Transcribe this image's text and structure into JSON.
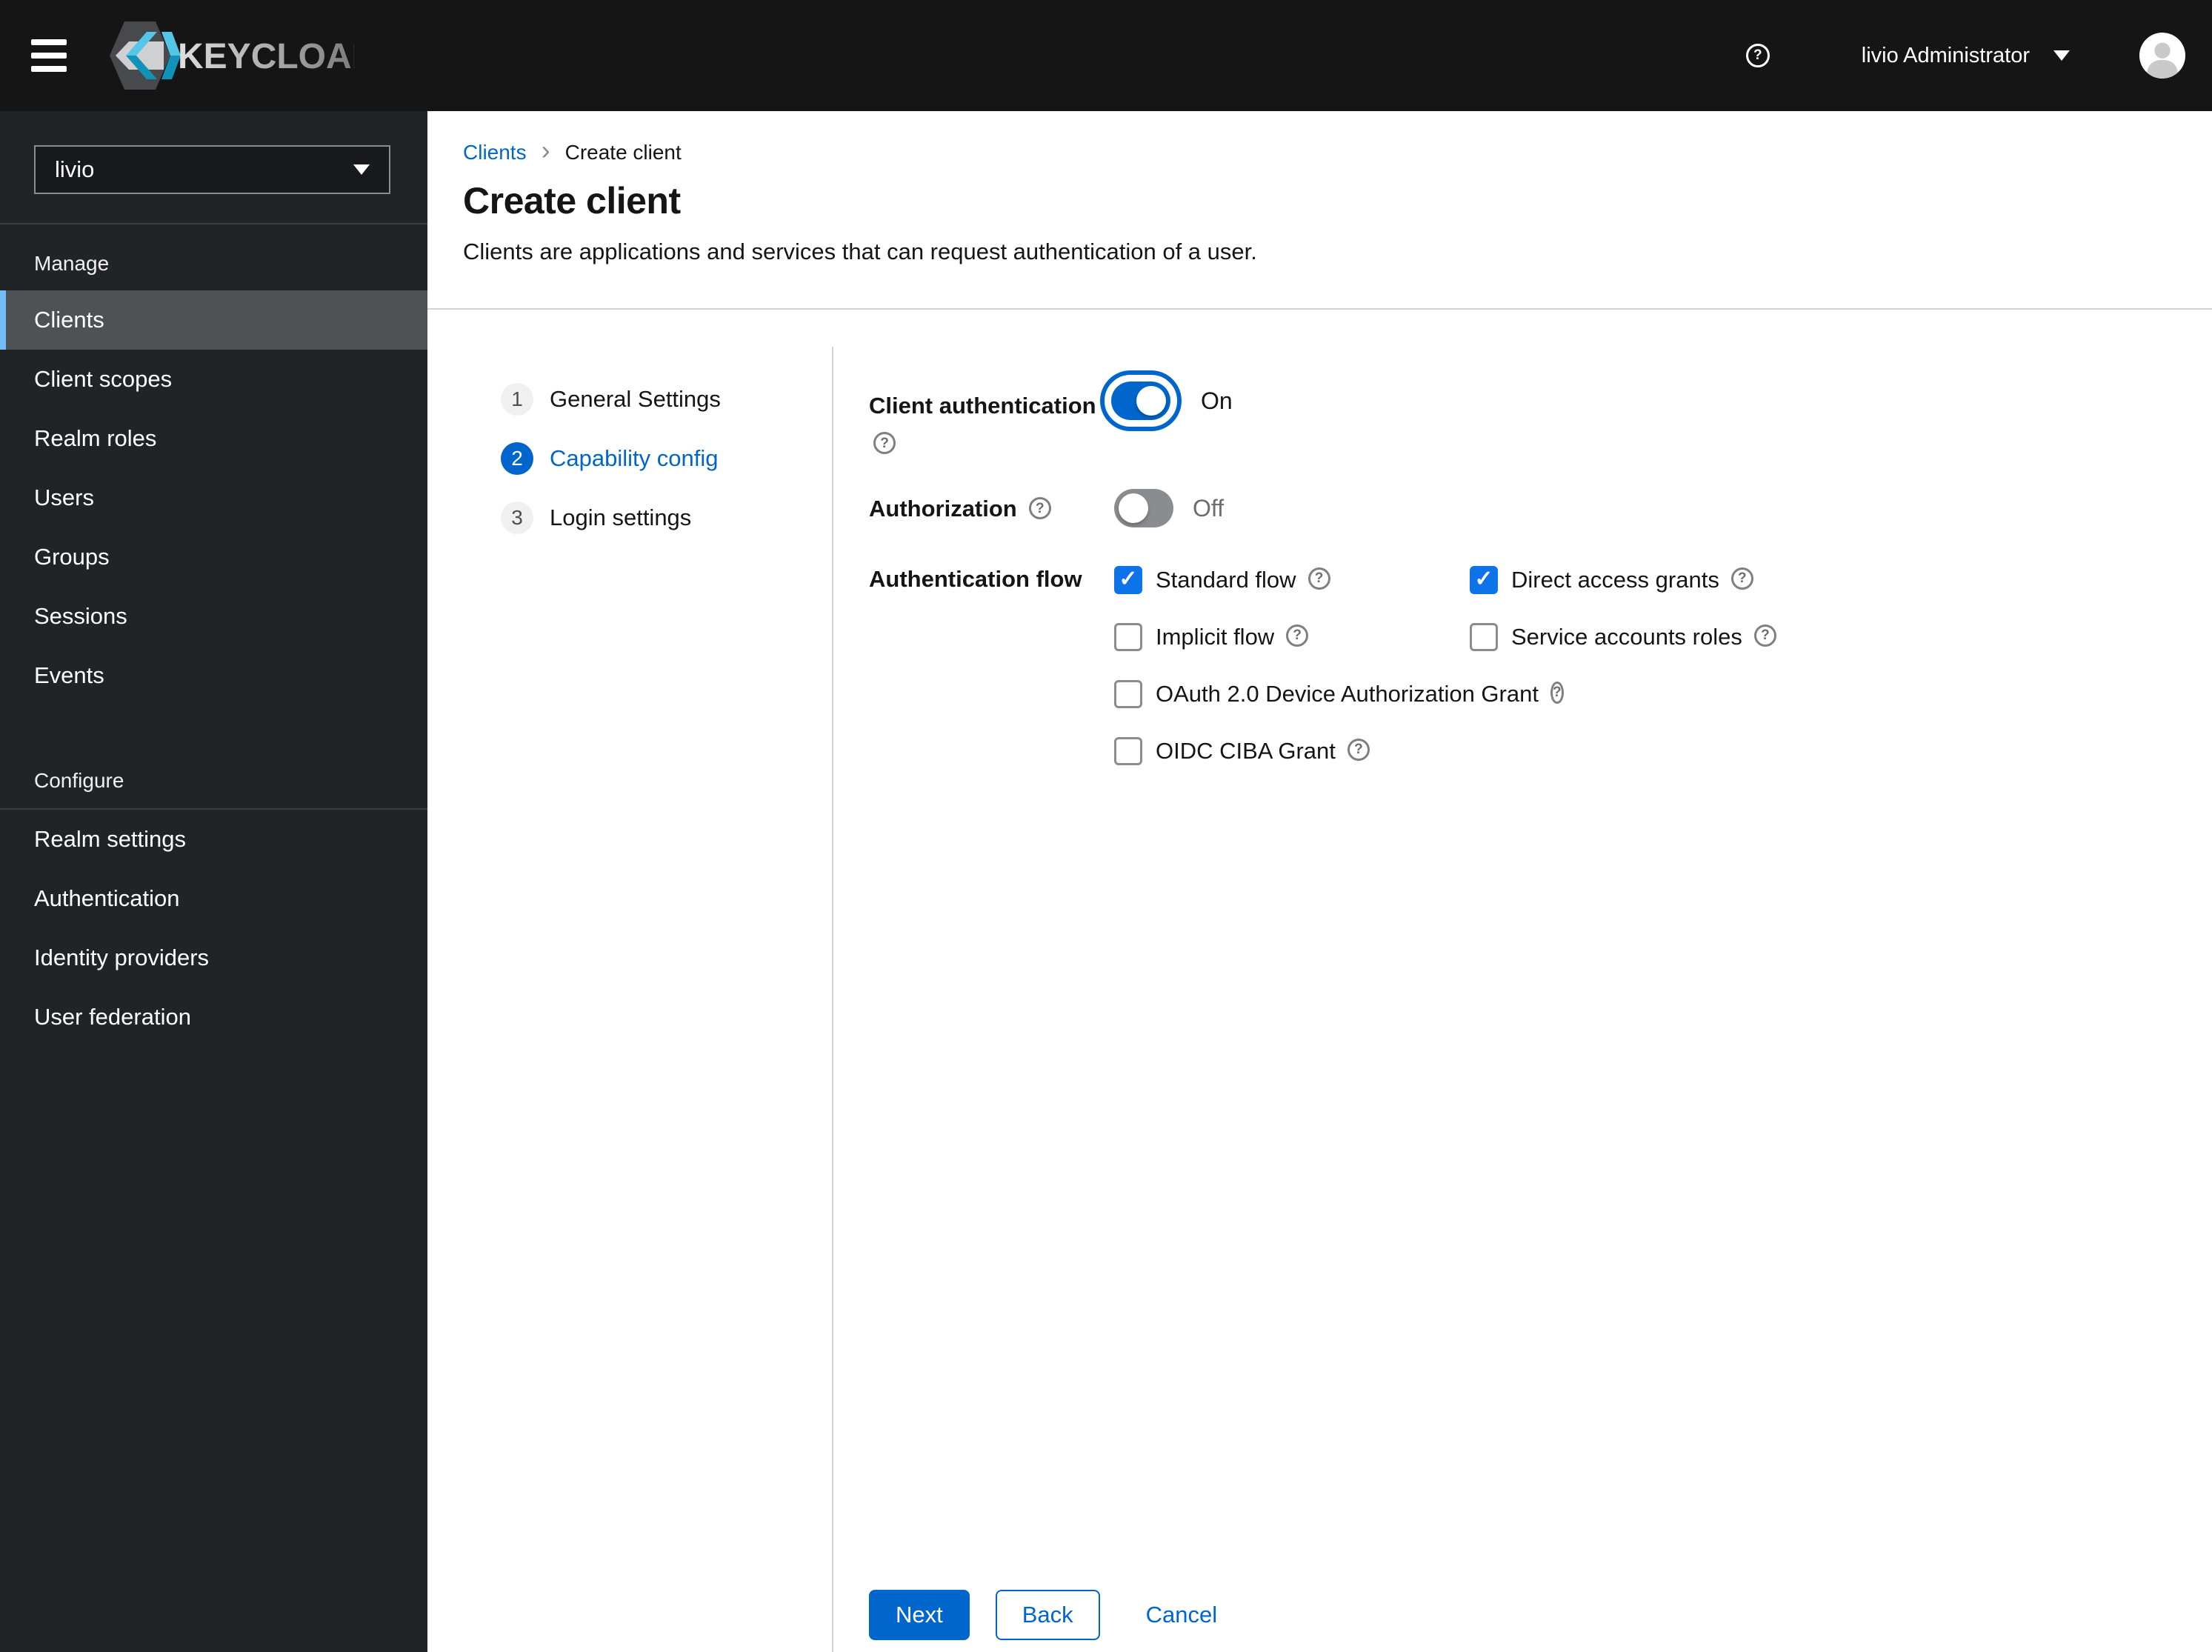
{
  "header": {
    "brand": "KEYCLOAK",
    "user": "livio Administrator"
  },
  "sidebar": {
    "realm": "livio",
    "sections": [
      {
        "title": "Manage",
        "items": [
          {
            "label": "Clients",
            "active": true
          },
          {
            "label": "Client scopes",
            "active": false
          },
          {
            "label": "Realm roles",
            "active": false
          },
          {
            "label": "Users",
            "active": false
          },
          {
            "label": "Groups",
            "active": false
          },
          {
            "label": "Sessions",
            "active": false
          },
          {
            "label": "Events",
            "active": false
          }
        ]
      },
      {
        "title": "Configure",
        "items": [
          {
            "label": "Realm settings",
            "active": false
          },
          {
            "label": "Authentication",
            "active": false
          },
          {
            "label": "Identity providers",
            "active": false
          },
          {
            "label": "User federation",
            "active": false
          }
        ]
      }
    ]
  },
  "breadcrumb": {
    "parent": "Clients",
    "current": "Create client"
  },
  "page": {
    "title": "Create client",
    "description": "Clients are applications and services that can request authentication of a user."
  },
  "wizard": {
    "steps": [
      {
        "number": "1",
        "label": "General Settings",
        "active": false
      },
      {
        "number": "2",
        "label": "Capability config",
        "active": true
      },
      {
        "number": "3",
        "label": "Login settings",
        "active": false
      }
    ]
  },
  "form": {
    "client_authentication": {
      "label": "Client authentication",
      "on": true,
      "state": "On"
    },
    "authorization": {
      "label": "Authorization",
      "on": false,
      "state": "Off"
    },
    "authentication_flow": {
      "label": "Authentication flow",
      "options": [
        {
          "label": "Standard flow",
          "checked": true
        },
        {
          "label": "Direct access grants",
          "checked": true
        },
        {
          "label": "Implicit flow",
          "checked": false
        },
        {
          "label": "Service accounts roles",
          "checked": false
        },
        {
          "label": "OAuth 2.0 Device Authorization Grant",
          "checked": false
        },
        {
          "label": "OIDC CIBA Grant",
          "checked": false
        }
      ]
    }
  },
  "actions": {
    "next": "Next",
    "back": "Back",
    "cancel": "Cancel"
  },
  "icons": {
    "help": "?",
    "check": "✓",
    "breadcrumb_separator": "›"
  },
  "colors": {
    "primary": "#0066cc",
    "header_bg": "#151515",
    "sidebar_bg": "#212427",
    "active_nav_bg": "#4f5255",
    "active_nav_border": "#73bcf7",
    "checkbox_checked": "#0c74e8",
    "toggle_off": "#8a8d90",
    "divider": "#d2d2d2",
    "logo_blue_light": "#54c6e8",
    "logo_blue_dark": "#1193b9"
  }
}
